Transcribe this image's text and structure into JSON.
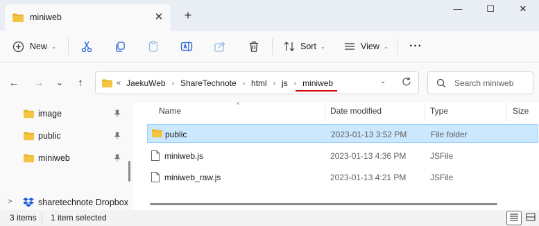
{
  "window": {
    "tab_title": "miniweb",
    "close_tab_glyph": "✕",
    "new_tab_glyph": "+",
    "minimize_glyph": "—",
    "maximize_glyph": "☐",
    "close_glyph": "✕"
  },
  "toolbar": {
    "new_label": "New",
    "sort_label": "Sort",
    "view_label": "View",
    "more_glyph": "···",
    "chevron_glyph": "⌄"
  },
  "nav": {
    "back_glyph": "←",
    "forward_glyph": "→",
    "recent_glyph": "⌄",
    "up_glyph": "↑"
  },
  "address": {
    "overflow_glyph": "«",
    "separator_glyph": "›",
    "crumbs": [
      "JaekuWeb",
      "ShareTechnote",
      "html",
      "js",
      "miniweb"
    ],
    "dropdown_glyph": "⌄"
  },
  "search": {
    "placeholder": "Search miniweb"
  },
  "sidebar": {
    "items": [
      {
        "label": "image",
        "pinned": true
      },
      {
        "label": "public",
        "pinned": true
      },
      {
        "label": "miniweb",
        "pinned": true
      },
      {
        "label": "sharetechnote Dropbox",
        "expander": ">"
      }
    ]
  },
  "columns": {
    "name": "Name",
    "date": "Date modified",
    "type": "Type",
    "size": "Size",
    "sort_glyph": "^"
  },
  "files": [
    {
      "name": "public",
      "date": "2023-01-13 3:52 PM",
      "type": "File folder",
      "kind": "folder",
      "selected": true
    },
    {
      "name": "miniweb.js",
      "date": "2023-01-13 4:36 PM",
      "type": "JSFile",
      "kind": "file",
      "selected": false
    },
    {
      "name": "miniweb_raw.js",
      "date": "2023-01-13 4:21 PM",
      "type": "JSFile",
      "kind": "file",
      "selected": false
    }
  ],
  "status": {
    "item_count": "3 items",
    "selection": "1 item selected"
  },
  "colors": {
    "folder": "#f4c542",
    "selection_bg": "#cce8ff",
    "selection_border": "#99d1ff",
    "annotation_underline": "#d40000",
    "dropbox_blue": "#1e5fd6"
  }
}
